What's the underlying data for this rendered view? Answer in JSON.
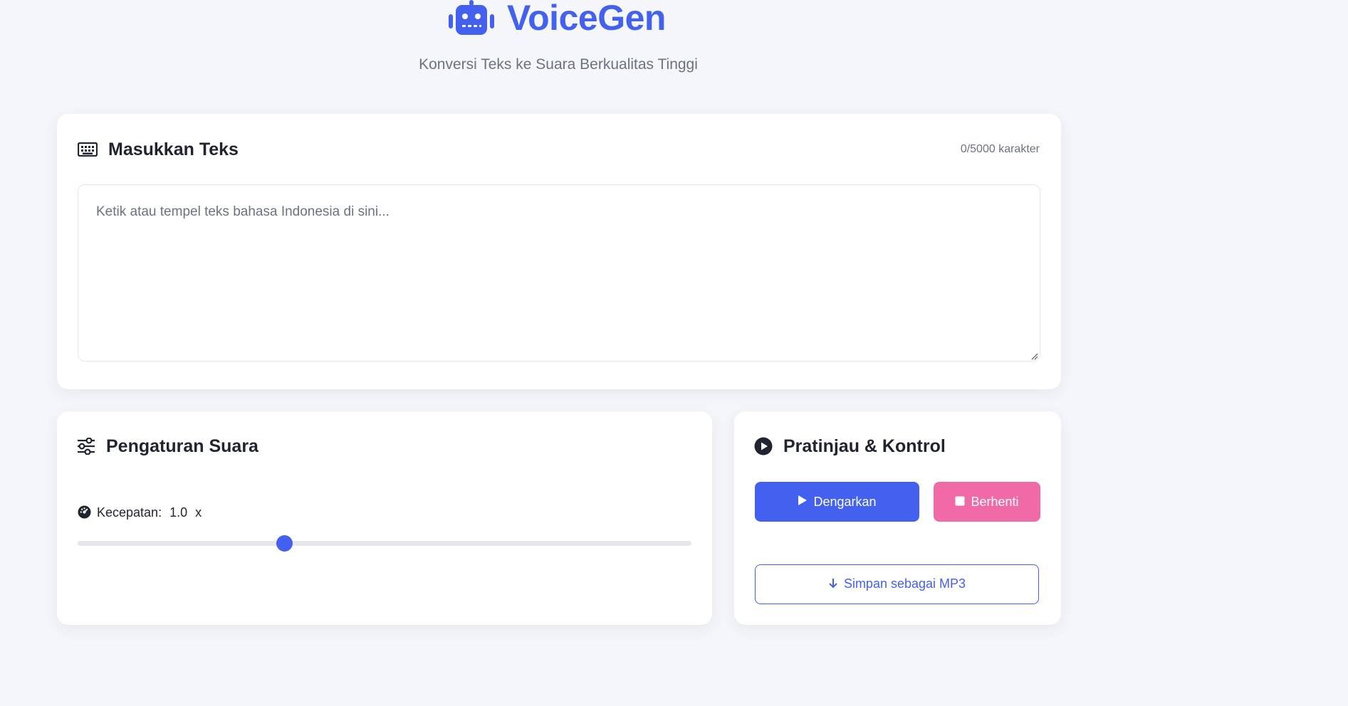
{
  "header": {
    "logo_icon": "robot-icon",
    "title": "VoiceGen",
    "subtitle": "Konversi Teks ke Suara Berkualitas Tinggi"
  },
  "input_card": {
    "icon": "keyboard-icon",
    "title": "Masukkan Teks",
    "char_count": "0/5000 karakter",
    "textarea_value": "",
    "textarea_placeholder": "Ketik atau tempel teks bahasa Indonesia di sini..."
  },
  "settings_card": {
    "icon": "sliders-icon",
    "title": "Pengaturan Suara",
    "speed": {
      "icon": "tachometer-icon",
      "label": "Kecepatan:",
      "value": "1.0",
      "unit": "x",
      "slider_fraction": 0.337
    }
  },
  "preview_card": {
    "icon": "play-circle-icon",
    "title": "Pratinjau & Kontrol",
    "play_label": "Dengarkan",
    "stop_label": "Berhenti",
    "save_label": "Simpan sebagai MP3"
  },
  "colors": {
    "accent": "#4361ee",
    "stop": "#f06aa8",
    "background": "#f5f6fa",
    "muted_text": "#6b7280"
  }
}
